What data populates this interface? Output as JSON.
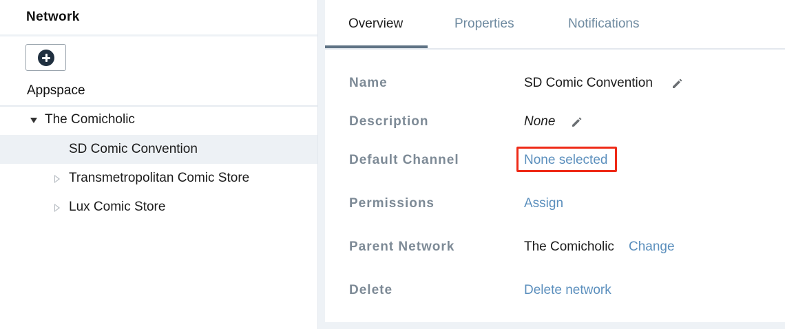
{
  "sidebar": {
    "title": "Network",
    "add_button_icon": "plus-circle-icon",
    "section_label": "Appspace",
    "tree": [
      {
        "label": "The Comicholic",
        "expanded": true,
        "selected": false
      },
      {
        "label": "SD Comic Convention",
        "selected": true
      },
      {
        "label": "Transmetropolitan Comic Store",
        "expanded": false,
        "selected": false
      },
      {
        "label": "Lux Comic Store",
        "expanded": false,
        "selected": false
      }
    ]
  },
  "tabs": [
    {
      "label": "Overview",
      "active": true
    },
    {
      "label": "Properties",
      "active": false
    },
    {
      "label": "Notifications",
      "active": false
    }
  ],
  "properties": {
    "name": {
      "label": "Name",
      "value": "SD Comic Convention",
      "edit_icon": "pencil-icon"
    },
    "description": {
      "label": "Description",
      "value": "None",
      "edit_icon": "pencil-icon"
    },
    "default_channel": {
      "label": "Default Channel",
      "value": "None selected"
    },
    "permissions": {
      "label": "Permissions",
      "value": "Assign"
    },
    "parent_network": {
      "label": "Parent Network",
      "value": "The Comicholic",
      "action": "Change"
    },
    "delete": {
      "label": "Delete",
      "value": "Delete network"
    }
  },
  "colors": {
    "link": "#5b8fbd",
    "highlight": "#ee2a17",
    "label": "#7d8a96",
    "selected_row": "#edf1f5"
  }
}
